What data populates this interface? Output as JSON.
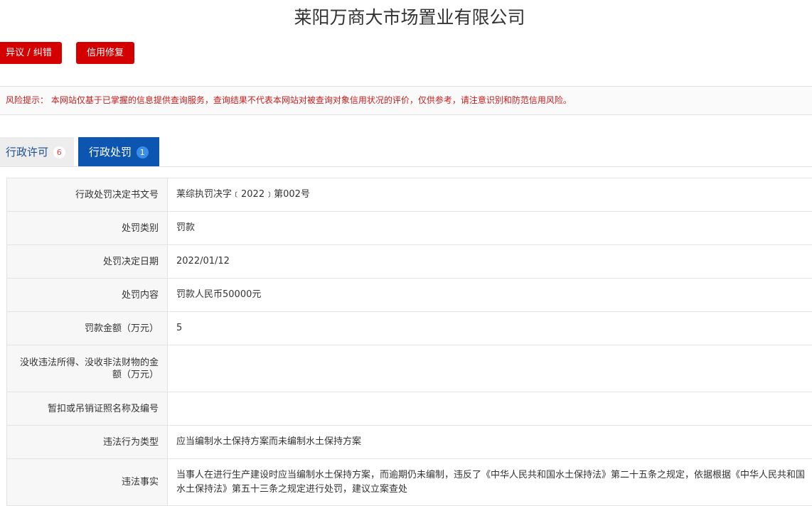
{
  "company_name": "莱阳万商大市场置业有限公司",
  "buttons": {
    "dispute": "异议 / 纠错",
    "credit_repair": "信用修复"
  },
  "risk_notice": "风险提示： 本网站仅基于已掌握的信息提供查询服务，查询结果不代表本网站对被查询对象信用状况的评价，仅供参考，请注意识别和防范信用风险。",
  "tabs": [
    {
      "label": "行政许可",
      "count": "6",
      "active": false
    },
    {
      "label": "行政处罚",
      "count": "1",
      "active": true
    }
  ],
  "penalty": {
    "rows": [
      {
        "label": "行政处罚决定书文号",
        "value": "莱综执罚决字﹝2022﹞第002号"
      },
      {
        "label": "处罚类别",
        "value": "罚款"
      },
      {
        "label": "处罚决定日期",
        "value": "2022/01/12"
      },
      {
        "label": "处罚内容",
        "value": "罚款人民币50000元"
      },
      {
        "label": "罚款金额（万元）",
        "value": "5"
      },
      {
        "label": "没收违法所得、没收非法财物的金额（万元）",
        "value": ""
      },
      {
        "label": "暂扣或吊销证照名称及编号",
        "value": ""
      },
      {
        "label": "违法行为类型",
        "value": "应当编制水土保持方案而未编制水土保持方案"
      },
      {
        "label": "违法事实",
        "value": "当事人在进行生产建设时应当编制水土保持方案，而逾期仍未编制，违反了《中华人民共和国水土保持法》第二十五条之规定，依据根据《中华人民共和国水土保持法》第五十三条之规定进行处罚，建议立案查处"
      }
    ]
  }
}
